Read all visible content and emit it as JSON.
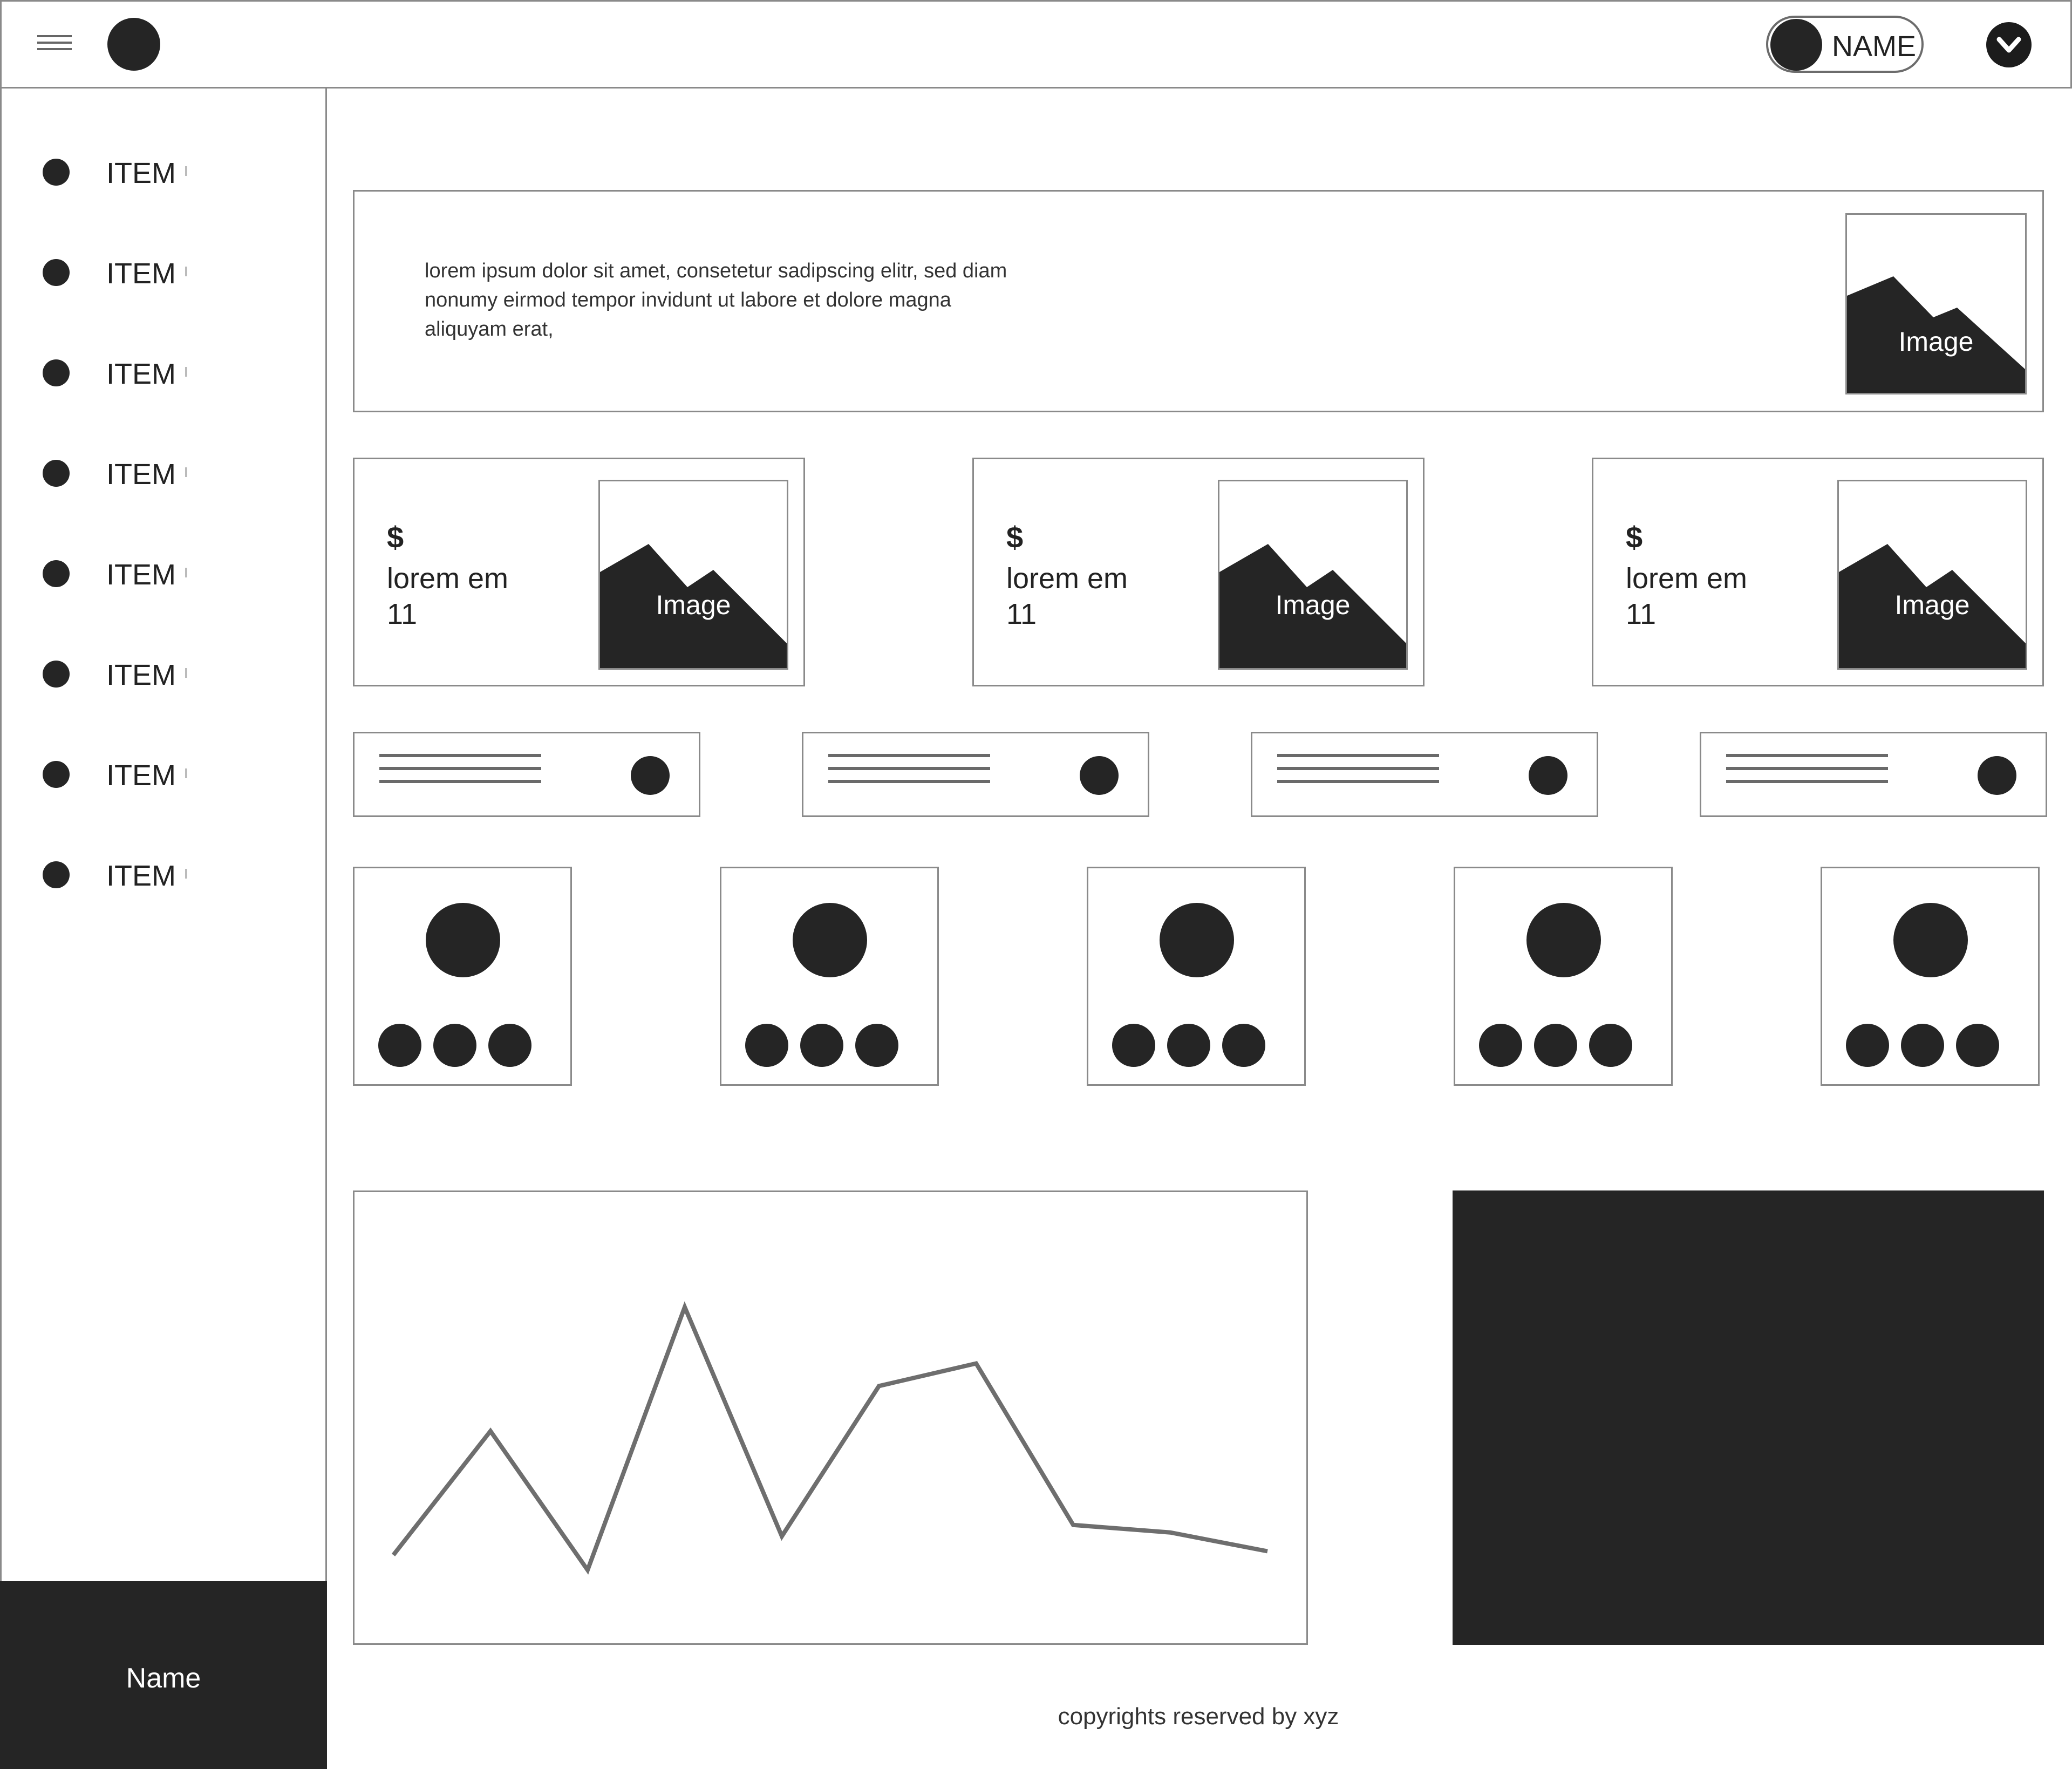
{
  "header": {
    "menu_icon": "hamburger-icon",
    "logo_icon": "circle-logo",
    "user_name": "NAME",
    "dropdown_icon": "chevron-down-icon"
  },
  "sidebar": {
    "items": [
      {
        "label": "ITEM",
        "icon": "bullet-icon"
      },
      {
        "label": "ITEM",
        "icon": "bullet-icon"
      },
      {
        "label": "ITEM",
        "icon": "bullet-icon"
      },
      {
        "label": "ITEM",
        "icon": "bullet-icon"
      },
      {
        "label": "ITEM",
        "icon": "bullet-icon"
      },
      {
        "label": "ITEM",
        "icon": "bullet-icon"
      },
      {
        "label": "ITEM",
        "icon": "bullet-icon"
      },
      {
        "label": "ITEM",
        "icon": "bullet-icon"
      }
    ],
    "footer_name": "Name"
  },
  "banner": {
    "text": "lorem ipsum dolor sit amet, consetetur sadipscing elitr, sed diam nonumy eirmod tempor invidunt ut labore et dolore magna aliquyam erat,",
    "image_label": "Image"
  },
  "cards": [
    {
      "currency": "$",
      "title": "lorem em",
      "value": "11",
      "image_label": "Image"
    },
    {
      "currency": "$",
      "title": "lorem em",
      "value": "11",
      "image_label": "Image"
    },
    {
      "currency": "$",
      "title": "lorem em",
      "value": "11",
      "image_label": "Image"
    }
  ],
  "chart_data": {
    "type": "line",
    "x": [
      1,
      2,
      3,
      4,
      5,
      6,
      7,
      8,
      9,
      10
    ],
    "series": [
      {
        "values": [
          12,
          45,
          8,
          78,
          17,
          57,
          63,
          20,
          18,
          13
        ]
      }
    ],
    "ylim": [
      0,
      100
    ],
    "grid": false
  },
  "footer": {
    "copyright": "copyrights reserved by xyz"
  }
}
